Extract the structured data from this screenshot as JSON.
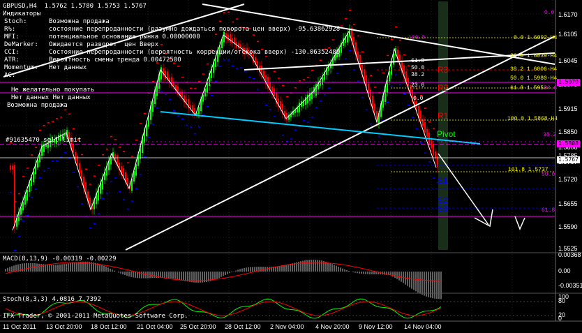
{
  "window": {
    "symbol_header": "GBPUSD,H4  1.5762 1.5780 1.5753 1.5767",
    "indicators_title": "Индикаторы"
  },
  "indicator_rows": [
    {
      "name": "Stoch:",
      "value": "Возможна продажа"
    },
    {
      "name": "R%:",
      "value": "состояние перепроданности (разумно дождаться поворота цен вверх) -95.63862928"
    },
    {
      "name": "MFI:",
      "value": "потенциальное основание рынка 0.00000000"
    },
    {
      "name": "DeMarker:",
      "value": "Ожидается разворот  цен Вверх"
    },
    {
      "name": "CCI:",
      "value": "Состояние перепроданности (вероятность коррекции/отскока вверх) -130.06352489"
    },
    {
      "name": "ATR:",
      "value": "Вероятность смены тренда 0.00472500"
    },
    {
      "name": "Momentum:",
      "value": "Нет данных"
    },
    {
      "name": "AC:",
      "value": ""
    }
  ],
  "advice_rows": [
    "Не желательно покупать",
    "Нет данных Нет данных",
    "Возможна продажа"
  ],
  "order_label": "#91635470 sell limit",
  "fib_labels": [
    {
      "text": "0.0",
      "color": "#ff00ff"
    },
    {
      "text": "100.0",
      "color": "#ff00ff"
    },
    {
      "text": "61.8",
      "color": "#ffffff"
    },
    {
      "text": "50.0",
      "color": "#ffffff"
    },
    {
      "text": "38.2",
      "color": "#ffffff"
    },
    {
      "text": "23.6",
      "color": "#ffffff"
    },
    {
      "text": "0.0",
      "color": "#ffffff"
    },
    {
      "text": "0.0 1.6092-H4",
      "color": "#ffff00"
    },
    {
      "text": "23.6 1.6039-H4",
      "color": "#ffff00"
    },
    {
      "text": "38.2 1.6006-H4",
      "color": "#ffff00"
    },
    {
      "text": "50.0 1.5980-H4",
      "color": "#ffff00"
    },
    {
      "text": "61.8 1.5953",
      "color": "#ffff00"
    },
    {
      "text": "23.6",
      "color": "#ff00ff"
    },
    {
      "text": "100.0 1.5868-H4",
      "color": "#ffff00"
    },
    {
      "text": "38.2",
      "color": "#ff00ff"
    },
    {
      "text": "50.0",
      "color": "#ff00ff"
    },
    {
      "text": "161.8 1.5737",
      "color": "#ffff00"
    },
    {
      "text": "61.8",
      "color": "#ff00ff"
    }
  ],
  "pivot_labels": [
    {
      "text": "R3",
      "color": "#ff0000"
    },
    {
      "text": "R2",
      "color": "#ff0000"
    },
    {
      "text": "R1",
      "color": "#ff0000"
    },
    {
      "text": "Pivot",
      "color": "#00ff00"
    },
    {
      "text": "S1",
      "color": "#0000ff"
    },
    {
      "text": "S2",
      "color": "#0000ff"
    },
    {
      "text": "S3",
      "color": "#0000ff"
    }
  ],
  "price_axis": [
    "1.6170",
    "1.6105",
    "1.6045",
    "1.5979",
    "1.5915",
    "1.5850",
    "1.5808",
    "1.5785",
    "1.5767",
    "1.5720",
    "1.5655",
    "1.5590",
    "1.5525"
  ],
  "price_badges": [
    {
      "text": "1.5979",
      "bg": "#ff00ff",
      "fg": "#000000"
    },
    {
      "text": "1.5808",
      "bg": "#ff00ff",
      "fg": "#000000"
    },
    {
      "text": "1.5767",
      "bg": "#ffffff",
      "fg": "#000000"
    }
  ],
  "macd": {
    "label": "MACD(8,13,9) -0.00319 -0.00229",
    "axis": [
      "0.00368",
      "0.00",
      "-0.00351"
    ]
  },
  "stoch": {
    "label": "Stoch(8,3,3) 4.0816 7.7392",
    "axis": [
      "100",
      "80",
      "20",
      "0"
    ],
    "credit": "IFX Trader, © 2001-2011 MetaQuotes Software Corp."
  },
  "time_axis": [
    "11 Oct 2011",
    "13 Oct 20:00",
    "18 Oct 12:00",
    "21 Oct 04:00",
    "25 Oct 20:00",
    "28 Oct 12:00",
    "2 Nov 04:00",
    "4 Nov 20:00",
    "9 Nov 12:00",
    "14 Nov 04:00"
  ],
  "colors": {
    "bull": "#00ff00",
    "bear": "#ff0000",
    "grid": "#3a3a3a",
    "trend": "#ffffff",
    "support": "#00ccff"
  }
}
